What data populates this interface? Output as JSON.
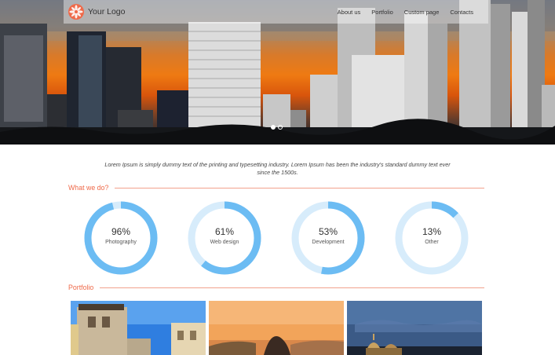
{
  "nav": {
    "logo_text": "Your Logo",
    "links": [
      "About us",
      "Portfolio",
      "Custom page",
      "Contacts"
    ]
  },
  "slider": {
    "dots": 2,
    "active_dot": 0
  },
  "intro": {
    "text": "Lorem Ipsum is simply dummy text of the printing and typesetting industry. Lorem Ipsum has been the industry's standard dummy text ever since the 1500s."
  },
  "sections": {
    "what_we_do": "What we do?",
    "portfolio": "Portfolio"
  },
  "skills": [
    {
      "label": "96%",
      "name": "Photography",
      "value": 96
    },
    {
      "label": "61%",
      "name": "Web design",
      "value": 61
    },
    {
      "label": "53%",
      "name": "Development",
      "value": 53
    },
    {
      "label": "13%",
      "name": "Other",
      "value": 13
    }
  ],
  "colors": {
    "accent": "#ef6a4a",
    "ring_fill": "#6cbcf3",
    "ring_track": "#d7ecfb"
  },
  "portfolio_items": [
    "thumb-1",
    "thumb-2",
    "thumb-3"
  ]
}
